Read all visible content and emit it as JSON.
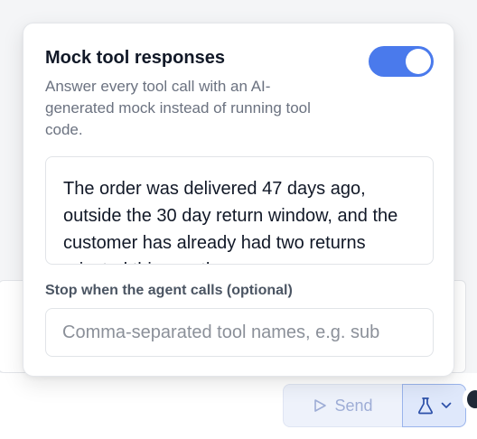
{
  "composer": {
    "send_label": "Send"
  },
  "popover": {
    "title": "Mock tool responses",
    "description": "Answer every tool call with an AI-generated mock instead of running tool code.",
    "toggle_on": true,
    "mock_text": "The order was delivered 47 days ago, outside the 30 day return window, and the customer has already had two returns rejected this month.",
    "stop_label": "Stop when the agent calls (optional)",
    "stop_placeholder": "Comma-separated tool names, e.g. sub",
    "stop_value": ""
  },
  "icons": {
    "send": "send-icon",
    "flask": "flask-icon",
    "chevron": "chevron-down-icon"
  },
  "colors": {
    "accent": "#4a7aec",
    "send_text": "#9eadd6",
    "mock_button_bg": "#dfe8fb"
  }
}
